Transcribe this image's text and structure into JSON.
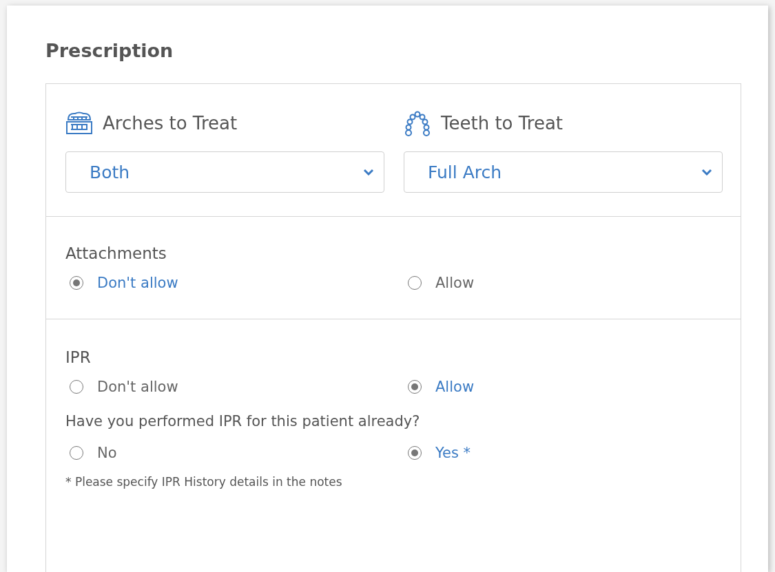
{
  "title": "Prescription",
  "selects": [
    {
      "label": "Arches to Treat",
      "kind": "arches",
      "value": "Both"
    },
    {
      "label": "Teeth to Treat",
      "kind": "teeth",
      "value": "Full Arch"
    }
  ],
  "groups": [
    {
      "label": "Attachments",
      "options": [
        {
          "label": "Don't allow",
          "selected": true
        },
        {
          "label": "Allow",
          "selected": false
        }
      ]
    },
    {
      "label": "IPR",
      "options": [
        {
          "label": "Don't allow",
          "selected": false
        },
        {
          "label": "Allow",
          "selected": true
        }
      ],
      "question": "Have you performed IPR for this patient already?",
      "answers": [
        {
          "label": "No",
          "selected": false
        },
        {
          "label": "Yes *",
          "selected": true
        }
      ],
      "note": "* Please specify IPR History details in the notes"
    }
  ]
}
